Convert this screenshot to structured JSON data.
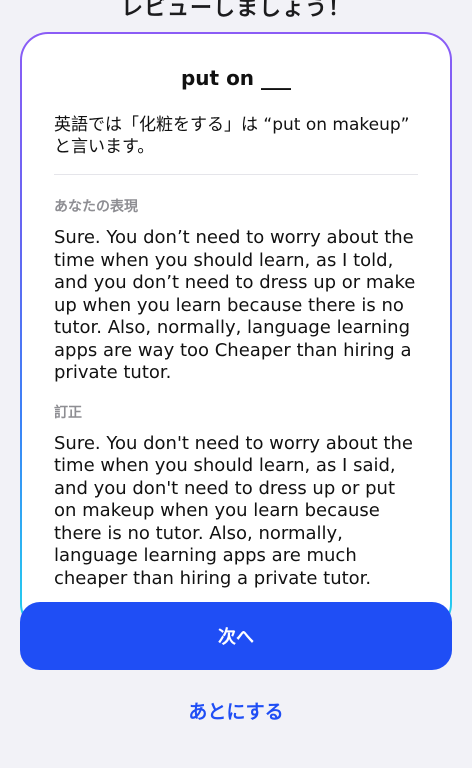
{
  "header": {
    "title": "レビューしましょう！"
  },
  "card": {
    "title": "put on ___",
    "explanation": "英語では「化粧をする」は “put on makeup” と言います。",
    "your_expression": {
      "label": "あなたの表現",
      "text": "Sure. You don’t need to worry about the time when you should learn, as I told, and you don’t need to dress up or make up when you learn because there is no tutor. Also, normally, language learning apps are way too Cheaper than hiring a private tutor."
    },
    "correction": {
      "label": "訂正",
      "text": "Sure. You don't need to worry about the time when you should learn, as I said, and you don't need to dress up or put on makeup when you learn because there is no tutor. Also, normally, language learning apps are much cheaper than hiring a private tutor."
    }
  },
  "actions": {
    "next_label": "次へ",
    "later_label": "あとにする"
  },
  "colors": {
    "primary": "#1f4ef5",
    "card_border_top": "#8b5cf6",
    "card_border_bottom": "#22d3ee",
    "background": "#f2f2f7",
    "label_gray": "#8e8e93"
  }
}
